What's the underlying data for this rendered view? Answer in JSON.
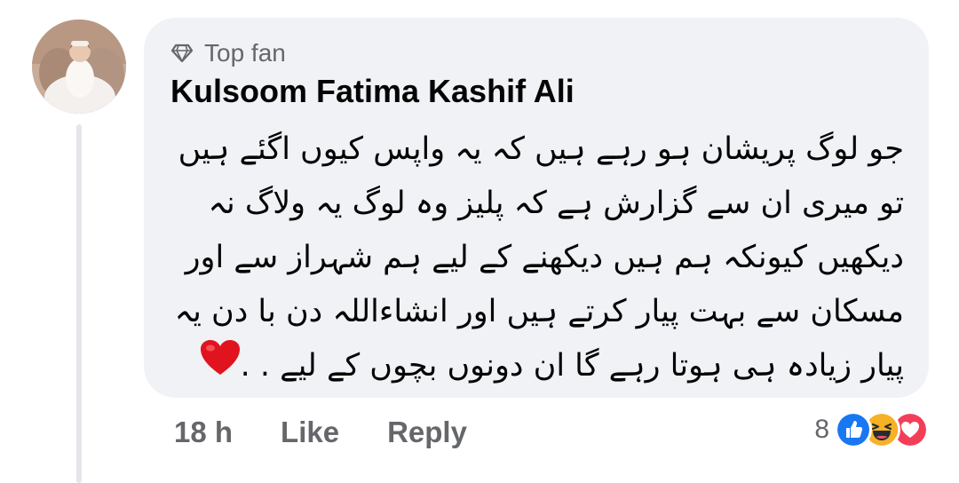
{
  "comment": {
    "badge": {
      "icon": "diamond-icon",
      "label": "Top fan"
    },
    "author": "Kulsoom Fatima Kashif Ali",
    "text_lines": [
      "جو لوگ پریشان ہو رہے ہیں کہ یہ واپس کیوں اگئے ہیں",
      "تو میری ان سے گزارش ہے کہ پلیز وہ لوگ یہ ولاگ نہ",
      "دیکھیں کیونکہ ہم ہیں دیکھنے کے لیے ہم شہراز سے اور",
      "مسکان سے بہت پیار کرتے ہیں اور انشاءاللہ دن با دن یہ",
      "پیار  زیادہ ہی ہوتا رہے گا ان دونوں بچوں کے لیے . ."
    ],
    "emoji": "red-heart-icon"
  },
  "actions": {
    "time": "18 h",
    "like": "Like",
    "reply": "Reply"
  },
  "reactions": {
    "count": "8",
    "icons": [
      "like-reaction-icon",
      "haha-reaction-icon",
      "love-reaction-icon"
    ]
  },
  "colors": {
    "bubble": "#f0f2f5",
    "secondary_text": "#65676b",
    "like_blue": "#1877f2",
    "love_red": "#f33e58",
    "haha_yellow": "#f7b125"
  }
}
